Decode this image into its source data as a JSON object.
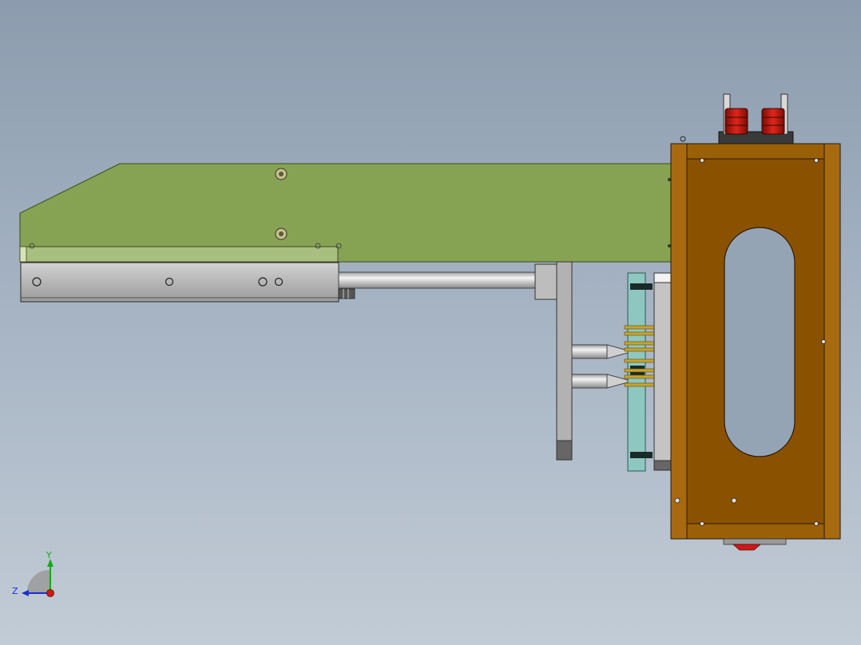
{
  "viewport": {
    "background_top": "#8c9cae",
    "background_bottom": "#c2ccd6"
  },
  "triad": {
    "y_label": "Y",
    "z_label": "Z",
    "y_color": "#18a818",
    "z_color": "#1a2fd0",
    "x_color": "#d01818"
  },
  "model": {
    "arm_color": "#86a353",
    "frame_color": "#8a5200",
    "frame_side_color": "#a86a10",
    "rail_color": "#b6b6b6",
    "rod_color": "#dedede",
    "plate_color": "#8ec7c0",
    "connector_color": "#c31a10",
    "pin_color": "#c8a42a"
  }
}
